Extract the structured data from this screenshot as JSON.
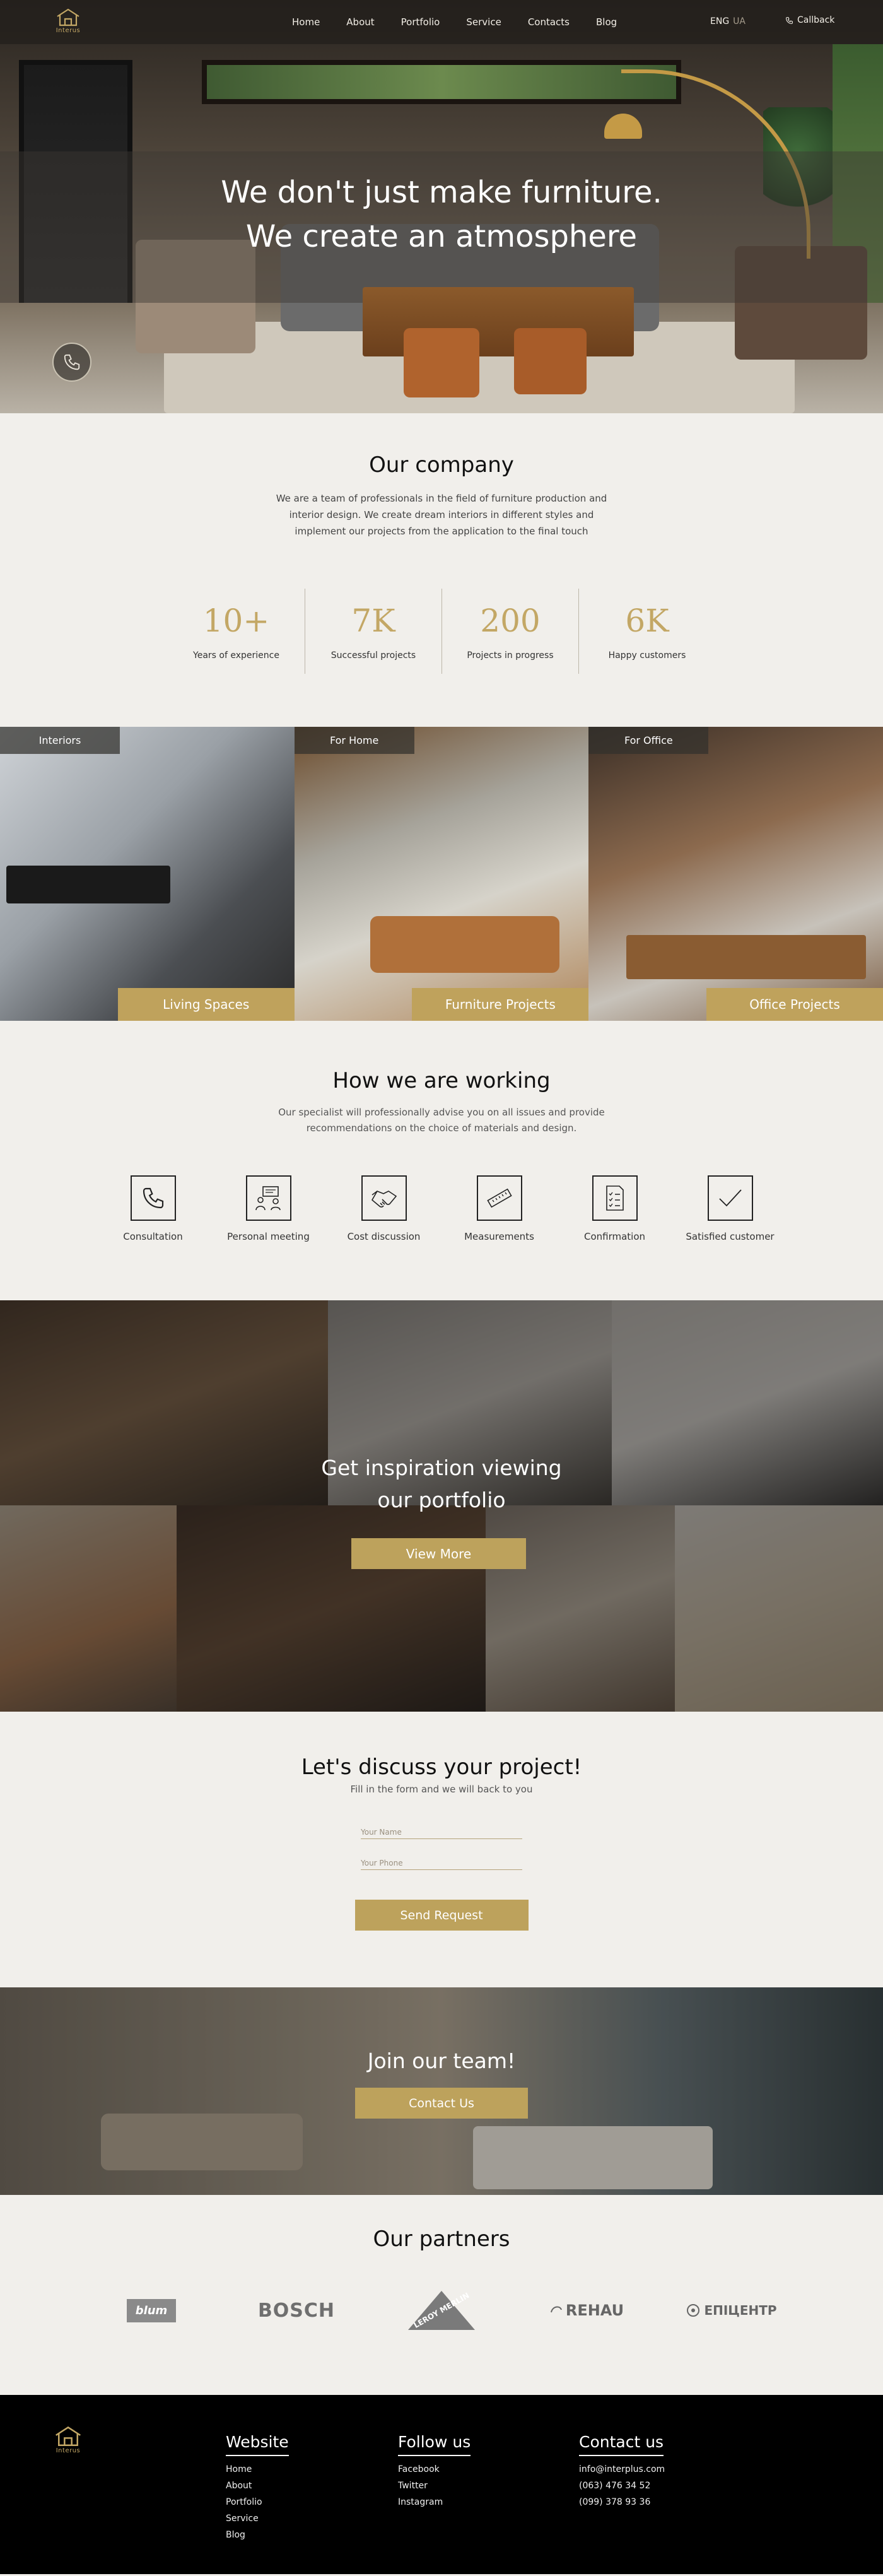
{
  "header": {
    "logo_text": "Interus",
    "nav": [
      "Home",
      "About",
      "Portfolio",
      "Service",
      "Contacts",
      "Blog"
    ],
    "lang_active": "ENG",
    "lang_other": "UA",
    "callback": "Callback"
  },
  "hero": {
    "title_line1": "We don't just make furniture.",
    "title_line2": "We create an atmosphere"
  },
  "company": {
    "title": "Our company",
    "text": "We are a team of professionals in the field of furniture production and interior design. We create dream interiors in different styles and implement our projects from the application to the final touch",
    "stats": [
      {
        "value": "10+",
        "label": "Years of experience"
      },
      {
        "value": "7K",
        "label": "Successful projects"
      },
      {
        "value": "200",
        "label": "Projects in progress"
      },
      {
        "value": "6K",
        "label": "Happy customers"
      }
    ]
  },
  "categories": [
    {
      "tag": "Interiors",
      "cta": "Living Spaces"
    },
    {
      "tag": "For Home",
      "cta": "Furniture Projects"
    },
    {
      "tag": "For Office",
      "cta": "Office Projects"
    }
  ],
  "working": {
    "title": "How we are working",
    "text": "Our specialist will professionally advise you on all issues and provide recommendations on the choice of materials and design.",
    "steps": [
      "Consultation",
      "Personal meeting",
      "Cost discussion",
      "Measurements",
      "Confirmation",
      "Satisfied customer"
    ]
  },
  "portfolio": {
    "title_line1": "Get inspiration viewing",
    "title_line2": "our portfolio",
    "button": "View More"
  },
  "discuss": {
    "title": "Let's discuss your project!",
    "subtitle": "Fill in the form and we will back to you",
    "name_placeholder": "Your Name",
    "phone_placeholder": "Your Phone",
    "button": "Send Request"
  },
  "join": {
    "title": "Join our team!",
    "button": "Contact Us"
  },
  "partners": {
    "title": "Our partners",
    "logos": [
      "blum",
      "BOSCH",
      "LEROY MERLIN",
      "REHAU",
      "ЕПІЦЕНТР"
    ]
  },
  "footer": {
    "logo_text": "Interus",
    "website": {
      "title": "Website",
      "links": [
        "Home",
        "About",
        "Portfolio",
        "Service",
        "Blog"
      ]
    },
    "follow": {
      "title": "Follow us",
      "links": [
        "Facebook",
        "Twitter",
        "Instagram"
      ]
    },
    "contact": {
      "title": "Contact us",
      "items": [
        "info@interplus.com",
        "(063) 476 34 52",
        "(099) 378 93 36"
      ]
    }
  }
}
